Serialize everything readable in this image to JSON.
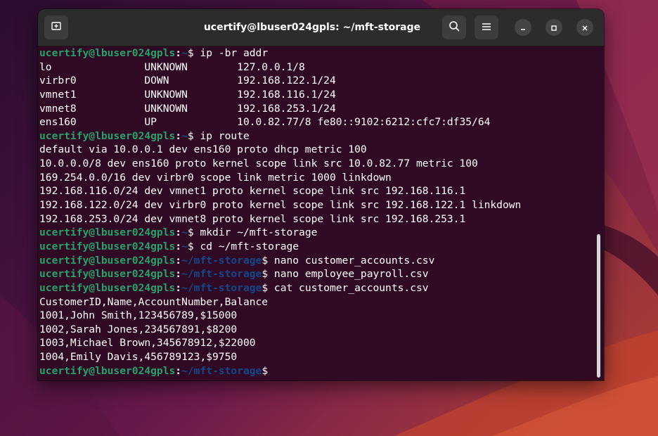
{
  "window": {
    "title": "ucertify@lbuser024gpls: ~/mft-storage"
  },
  "colors": {
    "terminal_bg": "#300a24",
    "prompt_user": "#26a269",
    "prompt_path": "#12488b",
    "titlebar_bg": "#2c2c2c"
  },
  "icons": {
    "new_tab": "new-tab-icon",
    "search": "search-icon",
    "menu": "hamburger-menu-icon",
    "minimize": "minimize-icon",
    "maximize": "maximize-icon",
    "close": "close-icon"
  },
  "terminal": {
    "lines": [
      {
        "type": "prompt",
        "user": "ucertify@lbuser024gpls",
        "colon": ":",
        "path": "~",
        "dollar": "$",
        "cmd": " ip -br addr"
      },
      {
        "type": "output",
        "text": "lo               UNKNOWN        127.0.0.1/8"
      },
      {
        "type": "output",
        "text": "virbr0           DOWN           192.168.122.1/24"
      },
      {
        "type": "output",
        "text": "vmnet1           UNKNOWN        192.168.116.1/24"
      },
      {
        "type": "output",
        "text": "vmnet8           UNKNOWN        192.168.253.1/24"
      },
      {
        "type": "output",
        "text": "ens160           UP             10.0.82.77/8 fe80::9102:6212:cfc7:df35/64"
      },
      {
        "type": "prompt",
        "user": "ucertify@lbuser024gpls",
        "colon": ":",
        "path": "~",
        "dollar": "$",
        "cmd": " ip route"
      },
      {
        "type": "output",
        "text": "default via 10.0.0.1 dev ens160 proto dhcp metric 100"
      },
      {
        "type": "output",
        "text": "10.0.0.0/8 dev ens160 proto kernel scope link src 10.0.82.77 metric 100"
      },
      {
        "type": "output",
        "text": "169.254.0.0/16 dev virbr0 scope link metric 1000 linkdown"
      },
      {
        "type": "output",
        "text": "192.168.116.0/24 dev vmnet1 proto kernel scope link src 192.168.116.1"
      },
      {
        "type": "output",
        "text": "192.168.122.0/24 dev virbr0 proto kernel scope link src 192.168.122.1 linkdown"
      },
      {
        "type": "output",
        "text": "192.168.253.0/24 dev vmnet8 proto kernel scope link src 192.168.253.1"
      },
      {
        "type": "prompt",
        "user": "ucertify@lbuser024gpls",
        "colon": ":",
        "path": "~",
        "dollar": "$",
        "cmd": " mkdir ~/mft-storage"
      },
      {
        "type": "prompt",
        "user": "ucertify@lbuser024gpls",
        "colon": ":",
        "path": "~",
        "dollar": "$",
        "cmd": " cd ~/mft-storage"
      },
      {
        "type": "prompt",
        "user": "ucertify@lbuser024gpls",
        "colon": ":",
        "path": "~/mft-storage",
        "dollar": "$",
        "cmd": " nano customer_accounts.csv"
      },
      {
        "type": "prompt",
        "user": "ucertify@lbuser024gpls",
        "colon": ":",
        "path": "~/mft-storage",
        "dollar": "$",
        "cmd": " nano employee_payroll.csv"
      },
      {
        "type": "prompt",
        "user": "ucertify@lbuser024gpls",
        "colon": ":",
        "path": "~/mft-storage",
        "dollar": "$",
        "cmd": " cat customer_accounts.csv"
      },
      {
        "type": "output",
        "text": "CustomerID,Name,AccountNumber,Balance"
      },
      {
        "type": "output",
        "text": "1001,John Smith,123456789,$15000"
      },
      {
        "type": "output",
        "text": "1002,Sarah Jones,234567891,$8200"
      },
      {
        "type": "output",
        "text": "1003,Michael Brown,345678912,$22000"
      },
      {
        "type": "output",
        "text": "1004,Emily Davis,456789123,$9750"
      },
      {
        "type": "prompt",
        "user": "ucertify@lbuser024gpls",
        "colon": ":",
        "path": "~/mft-storage",
        "dollar": "$",
        "cmd": ""
      }
    ]
  }
}
